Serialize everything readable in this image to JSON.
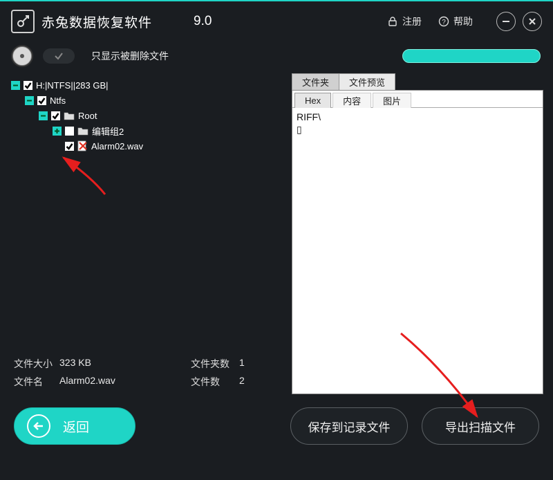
{
  "header": {
    "app_title": "赤兔数据恢复软件",
    "version": "9.0",
    "register": "注册",
    "help": "帮助"
  },
  "toolbar": {
    "deleted_only_label": "只显示被删除文件"
  },
  "tree": {
    "node0": "H:|NTFS||283 GB|",
    "node1": "Ntfs",
    "node2": "Root",
    "node3": "编辑组2",
    "node4": "Alarm02.wav"
  },
  "stats": {
    "size_label": "文件大小",
    "size_value": "323 KB",
    "folders_label": "文件夹数",
    "folders_value": "1",
    "name_label": "文件名",
    "name_value": "Alarm02.wav",
    "files_label": "文件数",
    "files_value": "2"
  },
  "preview": {
    "outer_tab_folder": "文件夹",
    "outer_tab_preview": "文件预览",
    "inner_tab_hex": "Hex",
    "inner_tab_content": "内容",
    "inner_tab_image": "图片",
    "content_text": "RIFF\\\n▯"
  },
  "buttons": {
    "back": "返回",
    "save_log": "保存到记录文件",
    "export": "导出扫描文件"
  }
}
